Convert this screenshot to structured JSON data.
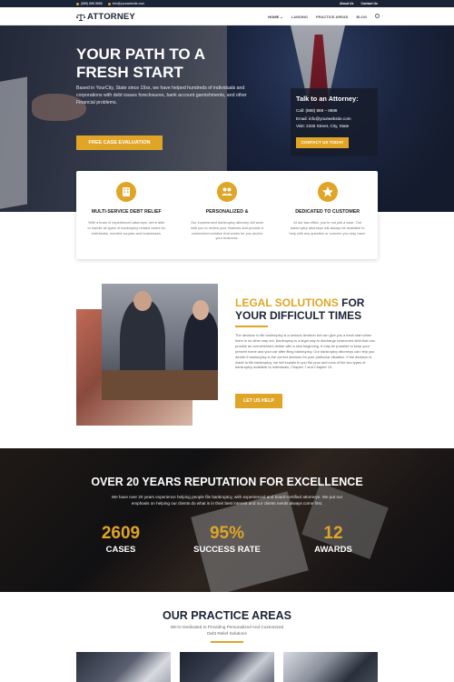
{
  "topbar": {
    "phone": "(888) 888 8888",
    "email": "info@yourwebsite.com",
    "about_us": "About Us",
    "contact_us": "Contact Us"
  },
  "header": {
    "logo_text": "ATTORNEY",
    "nav": [
      "HOME",
      "LANDING",
      "PRACTICE AREAS",
      "BLOG"
    ]
  },
  "hero": {
    "title": "YOUR PATH TO A FRESH START",
    "text": "Based in YourCity, State since 19xx, we have helped hundreds of individuals and corporations with debt issues foreclosures, bank account garnishments, and other Financial problems.",
    "button": "FREE CASE EVALUATION",
    "contact": {
      "title": "Talk to an Attorney:",
      "call": "Call: (888) 888 – 8888",
      "email": "Email: info@yourwebsite.com",
      "visit": "Visit: 2345 Street, City, State",
      "button": "CONTACT US TODAY"
    }
  },
  "features": [
    {
      "icon": "building-icon",
      "title": "MULTI-SERVICE DEBT RELIEF",
      "text": "With a team of experienced attorneys, we're able to handle all types of bankruptcy related cases for individuals, married couples and businesses."
    },
    {
      "icon": "people-icon",
      "title": "PERSONALIZED &",
      "text": "Our experienced bankruptcy attorney will work with you to review your finances and provide a customized solution that works for you and/or your business."
    },
    {
      "icon": "star-icon",
      "title": "DEDICATED TO CUSTOMER",
      "text": "At our law office, you're not just a case. Our bankruptcy attorneys will always be available to help with any question or concern you may have."
    }
  ],
  "legal": {
    "title_gold": "LEGAL SOLUTIONS",
    "title_rest_1": " FOR",
    "title_line2": "YOUR DIFFICULT TIMES",
    "text": "The decision to file bankruptcy is a serious decision but can give you a fresh start when there is no other way out. Bankruptcy is a legal way to discharge unsecured debt that can provide an overwhelmed debtor with a new beginning. It may be possible to keep your present home and your car after filing bankruptcy. Our bankruptcy attorneys can help you decide if bankruptcy is the correct decision for your particular situation. If the decision is made to file bankruptcy, we will explain to you the pros and cons of the two types of bankruptcy available to individuals, Chapter 7 and Chapter 13.",
    "button": "LET US HELP"
  },
  "stats": {
    "title": "OVER 20 YEARS REPUTATION FOR EXCELLENCE",
    "text": "We have over 20 years experience helping people file bankruptcy, with experienced and board-certified attorneys. We put our emphasis on helping our clients do what is in their best interest and our clients needs always come first.",
    "items": [
      {
        "number": "2609",
        "label": "CASES"
      },
      {
        "number": "95%",
        "label": "SUCCESS RATE"
      },
      {
        "number": "12",
        "label": "AWARDS"
      }
    ]
  },
  "practice": {
    "title": "OUR PRACTICE AREAS",
    "subtitle_1": "We're Dedicated to Providing Personalized And Customized",
    "subtitle_2": "Debt Relief Solutions"
  },
  "colors": {
    "accent": "#e0a526",
    "navy": "#1b2436"
  }
}
